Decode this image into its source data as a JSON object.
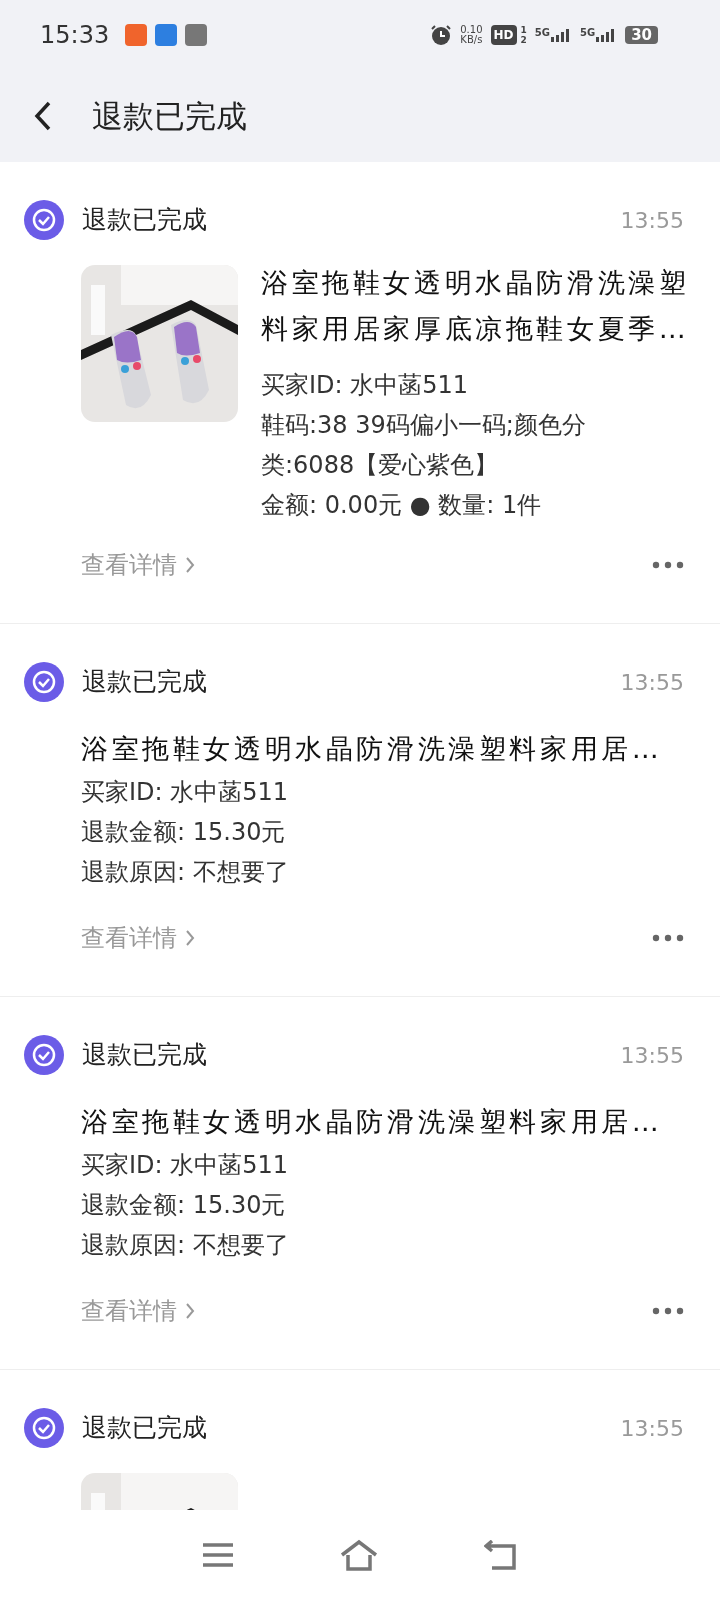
{
  "status_bar": {
    "time": "15:33",
    "net_speed": "0.10",
    "net_unit": "KB/s",
    "hd": "HD",
    "hd_sub": [
      "1",
      "2"
    ],
    "sims": [
      {
        "network": "5G"
      },
      {
        "network": "5G"
      }
    ],
    "battery": "30"
  },
  "header": {
    "title": "退款已完成"
  },
  "messages": [
    {
      "kind": "product",
      "status": "退款已完成",
      "time": "13:55",
      "title_lines": [
        "浴室拖鞋女透明水晶防滑洗澡塑",
        "料家用居家厚底凉拖鞋女夏季…"
      ],
      "detail_lines": [
        "买家ID: 水中菡511",
        "鞋码:38 39码偏小一码;颜色分",
        "类:6088【爱心紫色】",
        "金额: 0.00元 ● 数量: 1件"
      ],
      "link": "查看详情"
    },
    {
      "kind": "text",
      "status": "退款已完成",
      "time": "13:55",
      "title": "浴室拖鞋女透明水晶防滑洗澡塑料家用居…",
      "detail_lines": [
        "买家ID: 水中菡511",
        "退款金额: 15.30元",
        "退款原因: 不想要了"
      ],
      "link": "查看详情"
    },
    {
      "kind": "text",
      "status": "退款已完成",
      "time": "13:55",
      "title": "浴室拖鞋女透明水晶防滑洗澡塑料家用居…",
      "detail_lines": [
        "买家ID: 水中菡511",
        "退款金额: 15.30元",
        "退款原因: 不想要了"
      ],
      "link": "查看详情"
    },
    {
      "kind": "product",
      "status": "退款已完成",
      "time": "13:55"
    }
  ]
}
